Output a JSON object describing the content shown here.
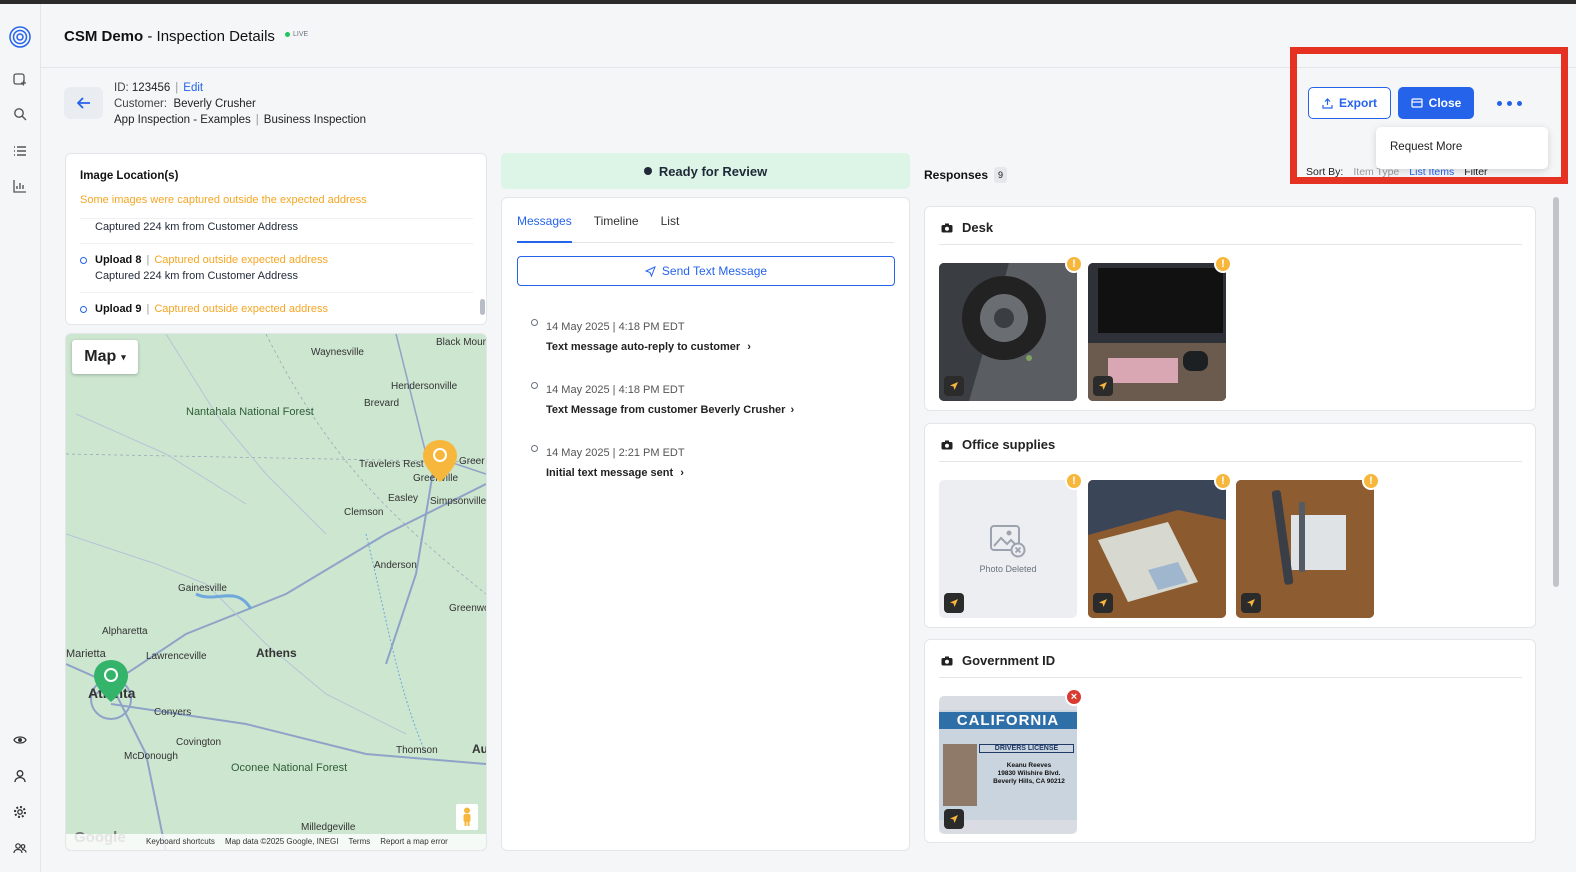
{
  "app": {
    "name": "CSM Demo",
    "separator": " - ",
    "page": "Inspection Details",
    "live_label": "LIVE"
  },
  "inspection": {
    "id_label": "ID:",
    "id_value": "123456",
    "edit_label": "Edit",
    "customer_label": "Customer:",
    "customer_value": "Beverly Crusher",
    "template": "App Inspection - Examples",
    "category": "Business Inspection"
  },
  "actions": {
    "export_label": "Export",
    "close_label": "Close",
    "menu_item": "Request More"
  },
  "sort": {
    "label": "Sort By:",
    "opt1": "Item Type",
    "opt2": "List Items",
    "filter": "Filter"
  },
  "image_locations": {
    "title": "Image Location(s)",
    "warning": "Some images were captured outside the expected address",
    "items": [
      {
        "name": "",
        "status": "",
        "detail": "Captured 224 km from Customer Address"
      },
      {
        "name": "Upload 8",
        "status": "Captured outside expected address",
        "detail": "Captured 224 km from Customer Address"
      },
      {
        "name": "Upload 9",
        "status": "Captured outside expected address",
        "detail": ""
      }
    ]
  },
  "map": {
    "type_label": "Map",
    "labels": {
      "waynesville": "Waynesville",
      "black_mountain": "Black Mountain",
      "hendersonville": "Hendersonville",
      "brevard": "Brevard",
      "nantahala": "Nantahala National Forest",
      "travelers_rest": "Travelers Rest",
      "greer": "Greer",
      "greenville": "Greenville",
      "easley": "Easley",
      "simpsonville": "Simpsonville",
      "clemson": "Clemson",
      "anderson": "Anderson",
      "gainesville": "Gainesville",
      "greenwood": "Greenwo",
      "alpharetta": "Alpharetta",
      "marietta": "Marietta",
      "lawrenceville": "Lawrenceville",
      "athens": "Athens",
      "atlanta": "Atlanta",
      "conyers": "Conyers",
      "covington": "Covington",
      "mcdonough": "McDonough",
      "oconee": "Oconee National Forest",
      "thomson": "Thomson",
      "au": "Au",
      "milledgeville": "Milledgeville"
    },
    "footer": {
      "shortcuts": "Keyboard shortcuts",
      "data": "Map data ©2025 Google, INEGI",
      "terms": "Terms",
      "report": "Report a map error",
      "logo": "Google"
    }
  },
  "status": {
    "label": "Ready for Review"
  },
  "messages": {
    "tabs": [
      "Messages",
      "Timeline",
      "List"
    ],
    "send_label": "Send Text Message",
    "items": [
      {
        "date": "14 May 2025 | 4:18 PM EDT",
        "text": "Text message auto-reply to customer"
      },
      {
        "date": "14 May 2025 | 4:18 PM EDT",
        "text": "Text Message from customer Beverly Crusher"
      },
      {
        "date": "14 May 2025 | 2:21 PM EDT",
        "text": "Initial text message sent"
      }
    ]
  },
  "responses": {
    "title": "Responses",
    "count": "9",
    "sections": [
      {
        "title": "Desk"
      },
      {
        "title": "Office supplies",
        "deleted_label": "Photo Deleted"
      },
      {
        "title": "Government ID"
      }
    ],
    "license": {
      "state": "CALIFORNIA",
      "type": "DRIVERS LICENSE",
      "name": "Keanu Reeves",
      "addr1": "19830 Wilshire Blvd.",
      "addr2": "Beverly Hills, CA 90212"
    }
  },
  "colors": {
    "primary": "#2563eb",
    "warning": "#f5a623",
    "status_bg": "#dcf5e6",
    "highlight": "#e53222"
  }
}
